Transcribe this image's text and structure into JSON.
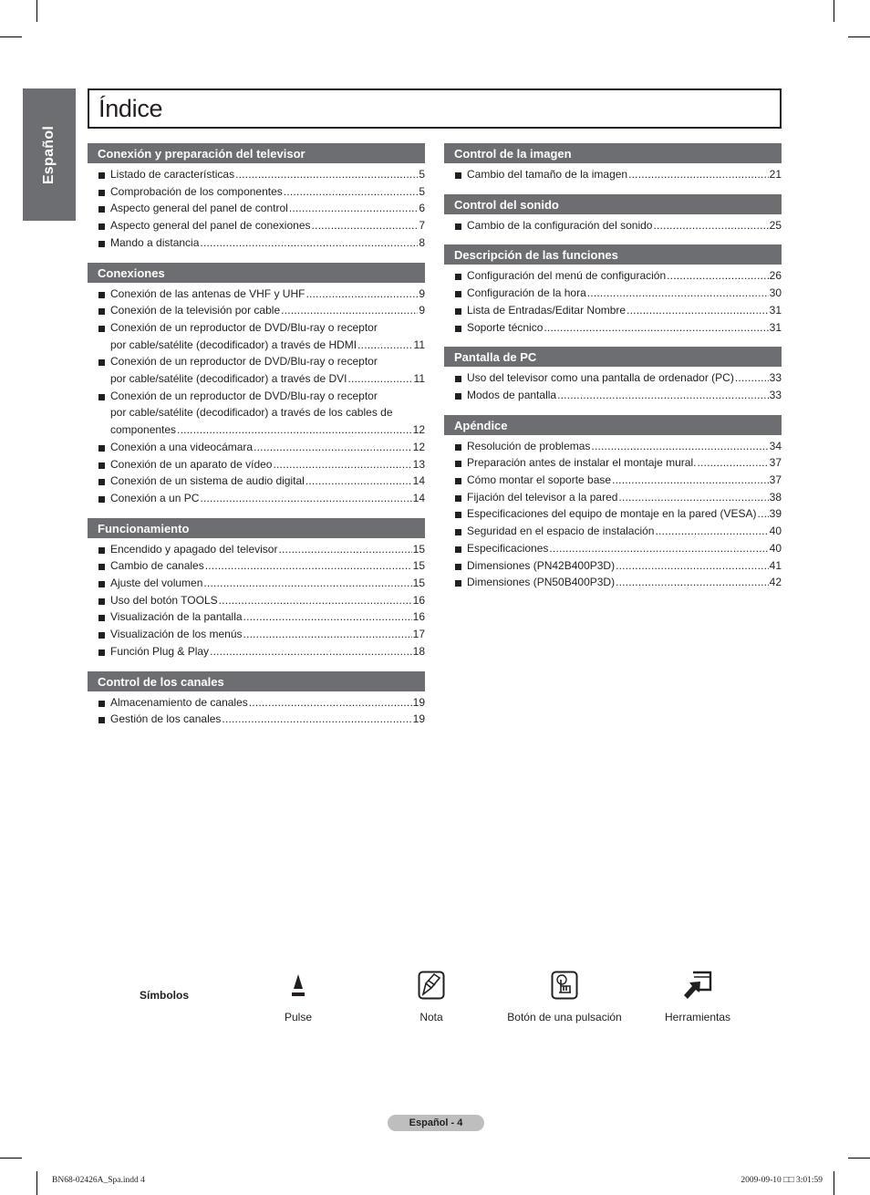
{
  "side_tab": {
    "label": "Español"
  },
  "title": "Índice",
  "left_sections": [
    {
      "heading": "Conexión y preparación del televisor",
      "items": [
        {
          "lines": [
            "Listado de características"
          ],
          "page": "5"
        },
        {
          "lines": [
            "Comprobación de los componentes"
          ],
          "page": "5"
        },
        {
          "lines": [
            "Aspecto general del panel de control"
          ],
          "page": "6"
        },
        {
          "lines": [
            "Aspecto general del panel de conexiones"
          ],
          "page": "7"
        },
        {
          "lines": [
            "Mando a distancia"
          ],
          "page": "8"
        }
      ]
    },
    {
      "heading": "Conexiones",
      "items": [
        {
          "lines": [
            "Conexión de las antenas de VHF y UHF"
          ],
          "page": "9"
        },
        {
          "lines": [
            "Conexión de la televisión por cable"
          ],
          "page": "9"
        },
        {
          "lines": [
            "Conexión de un reproductor de DVD/Blu-ray o receptor",
            "por cable/satélite (decodificador) a través de HDMI"
          ],
          "page": "11"
        },
        {
          "lines": [
            "Conexión de un reproductor de DVD/Blu-ray o receptor",
            "por cable/satélite (decodificador) a través de DVI"
          ],
          "page": "11"
        },
        {
          "lines": [
            "Conexión de un reproductor de DVD/Blu-ray o receptor",
            "por cable/satélite (decodificador) a través de los cables de",
            "componentes"
          ],
          "page": "12"
        },
        {
          "lines": [
            "Conexión a una videocámara"
          ],
          "page": "12"
        },
        {
          "lines": [
            "Conexión de un aparato de vídeo"
          ],
          "page": "13"
        },
        {
          "lines": [
            "Conexión de un sistema de audio digital"
          ],
          "page": "14"
        },
        {
          "lines": [
            "Conexión a un PC"
          ],
          "page": "14"
        }
      ]
    },
    {
      "heading": "Funcionamiento",
      "items": [
        {
          "lines": [
            "Encendido y apagado del televisor"
          ],
          "page": "15"
        },
        {
          "lines": [
            "Cambio de canales"
          ],
          "page": "15"
        },
        {
          "lines": [
            "Ajuste del volumen"
          ],
          "page": "15"
        },
        {
          "lines": [
            "Uso del botón TOOLS"
          ],
          "page": "16"
        },
        {
          "lines": [
            "Visualización de la pantalla"
          ],
          "page": "16"
        },
        {
          "lines": [
            "Visualización de los menús"
          ],
          "page": "17"
        },
        {
          "lines": [
            "Función Plug & Play"
          ],
          "page": "18"
        }
      ]
    },
    {
      "heading": "Control de los canales",
      "items": [
        {
          "lines": [
            "Almacenamiento de canales"
          ],
          "page": "19"
        },
        {
          "lines": [
            "Gestión de los canales"
          ],
          "page": "19"
        }
      ]
    }
  ],
  "right_sections": [
    {
      "heading": "Control de la imagen",
      "items": [
        {
          "lines": [
            "Cambio del tamaño de la imagen"
          ],
          "page": "21"
        }
      ]
    },
    {
      "heading": "Control del sonido",
      "items": [
        {
          "lines": [
            "Cambio de la configuración del sonido"
          ],
          "page": "25"
        }
      ]
    },
    {
      "heading": "Descripción de las funciones",
      "items": [
        {
          "lines": [
            "Configuración del menú de configuración"
          ],
          "page": "26"
        },
        {
          "lines": [
            "Configuración de la hora"
          ],
          "page": "30"
        },
        {
          "lines": [
            "Lista de Entradas/Editar Nombre"
          ],
          "page": "31"
        },
        {
          "lines": [
            "Soporte técnico"
          ],
          "page": "31"
        }
      ]
    },
    {
      "heading": "Pantalla de PC",
      "items": [
        {
          "lines": [
            "Uso del televisor como una pantalla de ordenador (PC)"
          ],
          "page": "33"
        },
        {
          "lines": [
            "Modos de pantalla"
          ],
          "page": "33"
        }
      ]
    },
    {
      "heading": "Apéndice",
      "items": [
        {
          "lines": [
            "Resolución de problemas"
          ],
          "page": "34"
        },
        {
          "lines": [
            "Preparación antes de instalar el montaje mural."
          ],
          "page": "37"
        },
        {
          "lines": [
            "Cómo montar el soporte base"
          ],
          "page": "37"
        },
        {
          "lines": [
            "Fijación del televisor a la pared"
          ],
          "page": "38"
        },
        {
          "lines": [
            "Especificaciones del equipo de montaje en la pared (VESA)"
          ],
          "page": "39"
        },
        {
          "lines": [
            "Seguridad en el espacio de instalación"
          ],
          "page": "40"
        },
        {
          "lines": [
            "Especificaciones"
          ],
          "page": "40"
        },
        {
          "lines": [
            "Dimensiones (PN42B400P3D)"
          ],
          "page": "41"
        },
        {
          "lines": [
            "Dimensiones (PN50B400P3D)"
          ],
          "page": "42"
        }
      ]
    }
  ],
  "symbols": {
    "label": "Símbolos",
    "items": [
      {
        "icon": "press-icon",
        "label": "Pulse"
      },
      {
        "icon": "note-icon",
        "label": "Nota"
      },
      {
        "icon": "one-touch-button-icon",
        "label": "Botón de una pulsación"
      },
      {
        "icon": "tools-icon",
        "label": "Herramientas"
      }
    ]
  },
  "footer": {
    "page_label": "Español - 4",
    "slug_left": "BN68-02426A_Spa.indd   4",
    "slug_right": "2009-09-10   □□ 3:01:59"
  }
}
